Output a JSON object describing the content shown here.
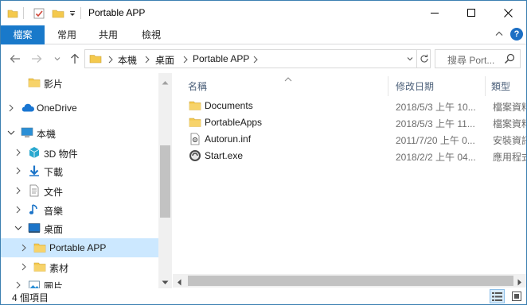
{
  "window": {
    "title": "Portable APP"
  },
  "ribbon": {
    "tabs": [
      "檔案",
      "常用",
      "共用",
      "檢視"
    ]
  },
  "address": {
    "crumbs": [
      "本機",
      "桌面",
      "Portable APP"
    ]
  },
  "search": {
    "placeholder": "搜尋 Port..."
  },
  "navpane": {
    "items": [
      {
        "label": "影片",
        "icon": "folder-icon",
        "indent": 1,
        "expand": "none",
        "selected": false
      },
      {
        "label": "OneDrive",
        "icon": "cloud-icon",
        "indent": 0,
        "expand": "collapsed",
        "selected": false
      },
      {
        "label": "本機",
        "icon": "computer-icon",
        "indent": 0,
        "expand": "expanded",
        "selected": false
      },
      {
        "label": "3D 物件",
        "icon": "cube-icon",
        "indent": 1,
        "expand": "collapsed",
        "selected": false
      },
      {
        "label": "下載",
        "icon": "download-icon",
        "indent": 1,
        "expand": "collapsed",
        "selected": false
      },
      {
        "label": "文件",
        "icon": "document-icon",
        "indent": 1,
        "expand": "collapsed",
        "selected": false
      },
      {
        "label": "音樂",
        "icon": "music-icon",
        "indent": 1,
        "expand": "collapsed",
        "selected": false
      },
      {
        "label": "桌面",
        "icon": "desktop-icon",
        "indent": 1,
        "expand": "expanded",
        "selected": false
      },
      {
        "label": "Portable APP",
        "icon": "folder-icon",
        "indent": 2,
        "expand": "collapsed",
        "selected": true
      },
      {
        "label": "素材",
        "icon": "folder-icon",
        "indent": 2,
        "expand": "collapsed",
        "selected": false
      },
      {
        "label": "圖片",
        "icon": "pictures-icon",
        "indent": 1,
        "expand": "collapsed",
        "selected": false
      }
    ]
  },
  "columns": {
    "name": "名稱",
    "date": "修改日期",
    "type": "類型"
  },
  "files": [
    {
      "name": "Documents",
      "date": "2018/5/3 上午 10...",
      "type": "檔案資料",
      "icon": "folder-icon"
    },
    {
      "name": "PortableApps",
      "date": "2018/5/3 上午 11...",
      "type": "檔案資料",
      "icon": "folder-icon"
    },
    {
      "name": "Autorun.inf",
      "date": "2011/7/20 上午 0...",
      "type": "安裝資訊",
      "icon": "settings-file-icon"
    },
    {
      "name": "Start.exe",
      "date": "2018/2/2 上午 04...",
      "type": "應用程式",
      "icon": "app-icon"
    }
  ],
  "status": {
    "count": "4 個項目"
  },
  "colors": {
    "accent": "#1979ca",
    "selection": "#cce8ff",
    "folder": "#f4c94d"
  }
}
